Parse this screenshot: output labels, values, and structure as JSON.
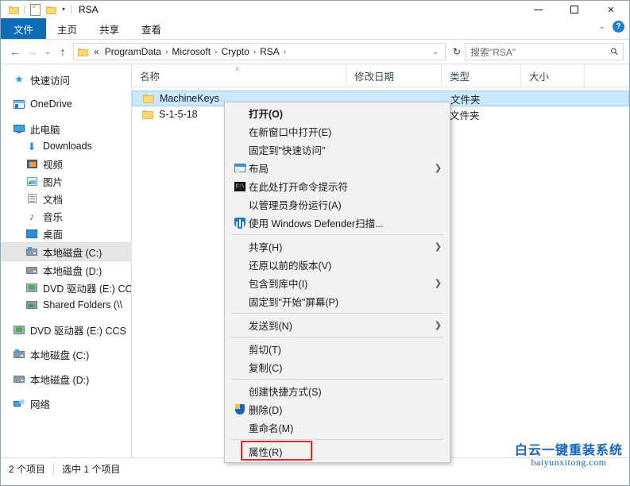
{
  "window": {
    "title": "RSA",
    "quick_access": [
      {
        "icon": "folder-icon",
        "name": "qat-folder"
      },
      {
        "icon": "properties-icon",
        "name": "qat-properties"
      },
      {
        "icon": "folder-icon",
        "name": "qat-new-folder"
      }
    ],
    "controls": {
      "minimize": "–",
      "maximize": "□",
      "close": "✕"
    }
  },
  "ribbon": {
    "tabs": [
      {
        "label": "文件",
        "active": true
      },
      {
        "label": "主页",
        "active": false
      },
      {
        "label": "共享",
        "active": false
      },
      {
        "label": "查看",
        "active": false
      }
    ],
    "collapse_icon": "chevron-down-icon",
    "help_label": "?"
  },
  "address": {
    "back": "←",
    "forward": "→",
    "recent": "⌄",
    "up": "↑",
    "prefix": "«",
    "breadcrumbs": [
      "ProgramData",
      "Microsoft",
      "Crypto",
      "RSA"
    ],
    "separator": "›",
    "dropdown": "⌄",
    "refresh": "↻"
  },
  "search": {
    "placeholder": "搜索\"RSA\"",
    "icon": "search-icon"
  },
  "sidebar": {
    "items": [
      {
        "label": "快速访问",
        "icon": "star-icon",
        "indent": 0,
        "selected": false,
        "gap_after": true
      },
      {
        "label": "OneDrive",
        "icon": "onedrive-icon",
        "indent": 0,
        "selected": false,
        "gap_after": true
      },
      {
        "label": "此电脑",
        "icon": "computer-icon",
        "indent": 0,
        "selected": false,
        "gap_after": false
      },
      {
        "label": "Downloads",
        "icon": "download-icon",
        "indent": 1,
        "selected": false,
        "gap_after": false
      },
      {
        "label": "视频",
        "icon": "video-icon",
        "indent": 1,
        "selected": false,
        "gap_after": false
      },
      {
        "label": "图片",
        "icon": "pictures-icon",
        "indent": 1,
        "selected": false,
        "gap_after": false
      },
      {
        "label": "文档",
        "icon": "documents-icon",
        "indent": 1,
        "selected": false,
        "gap_after": false
      },
      {
        "label": "音乐",
        "icon": "music-icon",
        "indent": 1,
        "selected": false,
        "gap_after": false
      },
      {
        "label": "桌面",
        "icon": "desktop-icon",
        "indent": 1,
        "selected": false,
        "gap_after": false
      },
      {
        "label": "本地磁盘 (C:)",
        "icon": "windows-drive-icon",
        "indent": 1,
        "selected": true,
        "gap_after": false
      },
      {
        "label": "本地磁盘 (D:)",
        "icon": "drive-icon",
        "indent": 1,
        "selected": false,
        "gap_after": false
      },
      {
        "label": "DVD 驱动器 (E:) CC",
        "icon": "dvd-icon",
        "indent": 1,
        "selected": false,
        "gap_after": false
      },
      {
        "label": "Shared Folders (\\\\",
        "icon": "shared-folder-icon",
        "indent": 1,
        "selected": false,
        "gap_after": true
      },
      {
        "label": "DVD 驱动器 (E:) CCS",
        "icon": "dvd-icon",
        "indent": 0,
        "selected": false,
        "gap_after": true
      },
      {
        "label": "本地磁盘 (C:)",
        "icon": "windows-drive-icon",
        "indent": 0,
        "selected": false,
        "gap_after": true
      },
      {
        "label": "本地磁盘 (D:)",
        "icon": "drive-icon",
        "indent": 0,
        "selected": false,
        "gap_after": true
      },
      {
        "label": "网络",
        "icon": "network-icon",
        "indent": 0,
        "selected": false,
        "gap_after": false
      }
    ]
  },
  "filelist": {
    "columns": [
      {
        "label": "名称",
        "key": "name"
      },
      {
        "label": "修改日期",
        "key": "date"
      },
      {
        "label": "类型",
        "key": "type"
      },
      {
        "label": "大小",
        "key": "size"
      }
    ],
    "sort_indicator": "˄",
    "rows": [
      {
        "name": "MachineKeys",
        "date": "",
        "type": "文件夹",
        "size": "",
        "selected": true
      },
      {
        "name": "S-1-5-18",
        "date": "",
        "type": "文件夹",
        "size": "",
        "selected": false
      }
    ]
  },
  "context_menu": {
    "items": [
      {
        "label": "打开(O)",
        "icon": null,
        "bold": true,
        "arrow": false
      },
      {
        "label": "在新窗口中打开(E)",
        "icon": null,
        "bold": false,
        "arrow": false
      },
      {
        "label": "固定到\"快速访问\"",
        "icon": null,
        "bold": false,
        "arrow": false
      },
      {
        "label": "布局",
        "icon": "layout-icon",
        "bold": false,
        "arrow": true
      },
      {
        "label": "在此处打开命令提示符",
        "icon": "command-prompt-icon",
        "bold": false,
        "arrow": false
      },
      {
        "label": "以管理员身份运行(A)",
        "icon": null,
        "bold": false,
        "arrow": false
      },
      {
        "label": "使用 Windows Defender扫描...",
        "icon": "defender-shield-icon",
        "bold": false,
        "arrow": false
      },
      {
        "separator": true
      },
      {
        "label": "共享(H)",
        "icon": null,
        "bold": false,
        "arrow": true
      },
      {
        "label": "还原以前的版本(V)",
        "icon": null,
        "bold": false,
        "arrow": false
      },
      {
        "label": "包含到库中(I)",
        "icon": null,
        "bold": false,
        "arrow": true
      },
      {
        "label": "固定到\"开始\"屏幕(P)",
        "icon": null,
        "bold": false,
        "arrow": false
      },
      {
        "separator": true
      },
      {
        "label": "发送到(N)",
        "icon": null,
        "bold": false,
        "arrow": true
      },
      {
        "separator": true
      },
      {
        "label": "剪切(T)",
        "icon": null,
        "bold": false,
        "arrow": false
      },
      {
        "label": "复制(C)",
        "icon": null,
        "bold": false,
        "arrow": false
      },
      {
        "separator": true
      },
      {
        "label": "创建快捷方式(S)",
        "icon": null,
        "bold": false,
        "arrow": false
      },
      {
        "label": "删除(D)",
        "icon": "uac-shield-icon",
        "bold": false,
        "arrow": false
      },
      {
        "label": "重命名(M)",
        "icon": null,
        "bold": false,
        "arrow": false
      },
      {
        "separator": true
      },
      {
        "label": "属性(R)",
        "icon": null,
        "bold": false,
        "arrow": false,
        "highlight_box": true
      }
    ],
    "highlight_color": "#e8262b"
  },
  "statusbar": {
    "item_count": "2 个项目",
    "selection": "选中 1 个项目"
  },
  "watermark": {
    "chinese": "白云一键重装系统",
    "english": "baiyunxitong.com",
    "color": "#1565c0"
  }
}
